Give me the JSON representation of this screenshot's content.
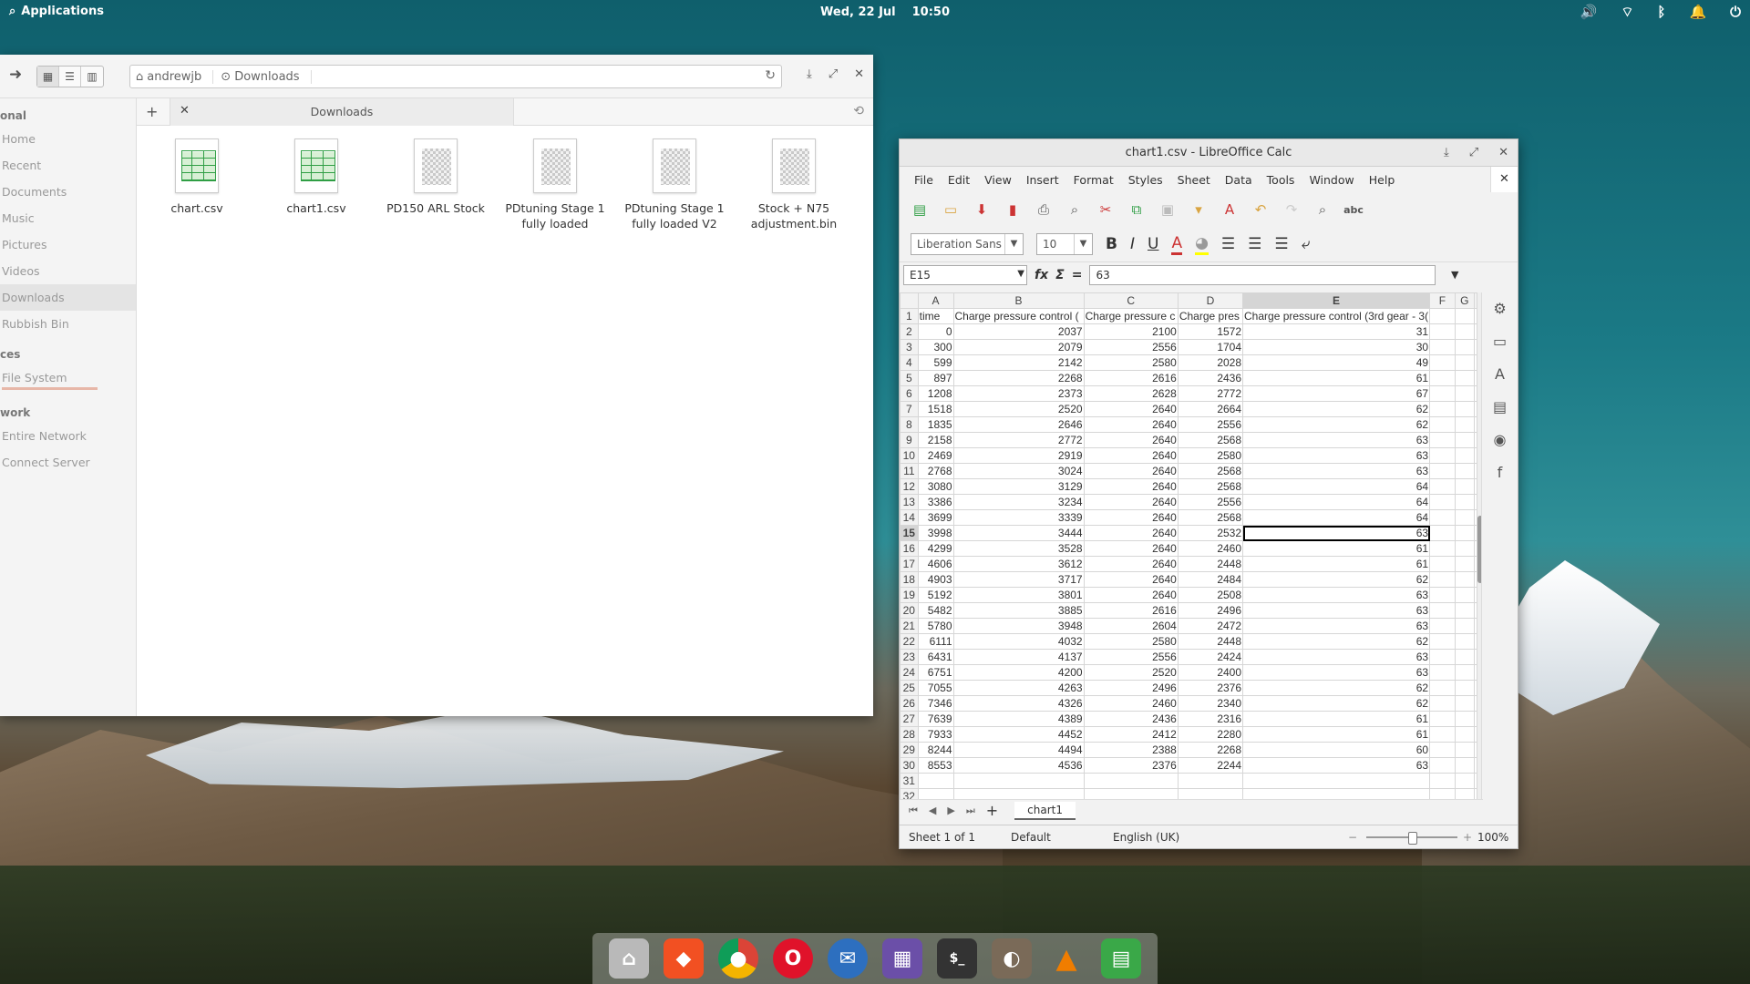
{
  "top_panel": {
    "applications_label": "Applications",
    "date": "Wed, 22 Jul",
    "time": "10:50"
  },
  "file_manager": {
    "breadcrumb": [
      "andrewjb",
      "Downloads"
    ],
    "tab_label": "Downloads",
    "sidebar": {
      "personal_heading": "onal",
      "personal_items": [
        "Home",
        "Recent",
        "Documents",
        "Music",
        "Pictures",
        "Videos",
        "Downloads",
        "Rubbish Bin"
      ],
      "devices_heading": "ces",
      "device_items": [
        "File System"
      ],
      "network_heading": "work",
      "network_items": [
        "Entire Network",
        "Connect Server"
      ]
    },
    "files": [
      {
        "name": "chart.csv",
        "type": "sheet"
      },
      {
        "name": "chart1.csv",
        "type": "sheet"
      },
      {
        "name": "PD150 ARL Stock",
        "type": "bin"
      },
      {
        "name": "PDtuning Stage 1 fully loaded",
        "type": "bin"
      },
      {
        "name": "PDtuning Stage 1 fully loaded V2",
        "type": "bin"
      },
      {
        "name": "Stock + N75 adjustment.bin",
        "type": "bin"
      }
    ]
  },
  "calc": {
    "title": "chart1.csv - LibreOffice Calc",
    "menu": [
      "File",
      "Edit",
      "View",
      "Insert",
      "Format",
      "Styles",
      "Sheet",
      "Data",
      "Tools",
      "Window",
      "Help"
    ],
    "font_name": "Liberation Sans",
    "font_size": "10",
    "name_box": "E15",
    "formula_value": "63",
    "columns": [
      "A",
      "B",
      "C",
      "D",
      "E",
      "F",
      "G"
    ],
    "header_row": [
      "time",
      "Charge pressure control (",
      "Charge pressure c",
      "Charge pres",
      "Charge pressure control (3rd gear - 3(",
      "",
      ""
    ],
    "rows": [
      [
        0,
        2037,
        2100,
        1572,
        31
      ],
      [
        300,
        2079,
        2556,
        1704,
        30
      ],
      [
        599,
        2142,
        2580,
        2028,
        49
      ],
      [
        897,
        2268,
        2616,
        2436,
        61
      ],
      [
        1208,
        2373,
        2628,
        2772,
        67
      ],
      [
        1518,
        2520,
        2640,
        2664,
        62
      ],
      [
        1835,
        2646,
        2640,
        2556,
        62
      ],
      [
        2158,
        2772,
        2640,
        2568,
        63
      ],
      [
        2469,
        2919,
        2640,
        2580,
        63
      ],
      [
        2768,
        3024,
        2640,
        2568,
        63
      ],
      [
        3080,
        3129,
        2640,
        2568,
        64
      ],
      [
        3386,
        3234,
        2640,
        2556,
        64
      ],
      [
        3699,
        3339,
        2640,
        2568,
        64
      ],
      [
        3998,
        3444,
        2640,
        2532,
        63
      ],
      [
        4299,
        3528,
        2640,
        2460,
        61
      ],
      [
        4606,
        3612,
        2640,
        2448,
        61
      ],
      [
        4903,
        3717,
        2640,
        2484,
        62
      ],
      [
        5192,
        3801,
        2640,
        2508,
        63
      ],
      [
        5482,
        3885,
        2616,
        2496,
        63
      ],
      [
        5780,
        3948,
        2604,
        2472,
        63
      ],
      [
        6111,
        4032,
        2580,
        2448,
        62
      ],
      [
        6431,
        4137,
        2556,
        2424,
        63
      ],
      [
        6751,
        4200,
        2520,
        2400,
        63
      ],
      [
        7055,
        4263,
        2496,
        2376,
        62
      ],
      [
        7346,
        4326,
        2460,
        2340,
        62
      ],
      [
        7639,
        4389,
        2436,
        2316,
        61
      ],
      [
        7933,
        4452,
        2412,
        2280,
        61
      ],
      [
        8244,
        4494,
        2388,
        2268,
        60
      ],
      [
        8553,
        4536,
        2376,
        2244,
        63
      ]
    ],
    "selected_row": 15,
    "selected_col": "E",
    "sheet_tab": "chart1",
    "status": {
      "sheet": "Sheet 1 of 1",
      "style": "Default",
      "language": "English (UK)",
      "zoom": "100%"
    }
  },
  "dock_apps": [
    "files",
    "brave",
    "chrome",
    "opera",
    "thunderbird",
    "appcenter",
    "terminal",
    "gimp",
    "vlc",
    "calc"
  ]
}
